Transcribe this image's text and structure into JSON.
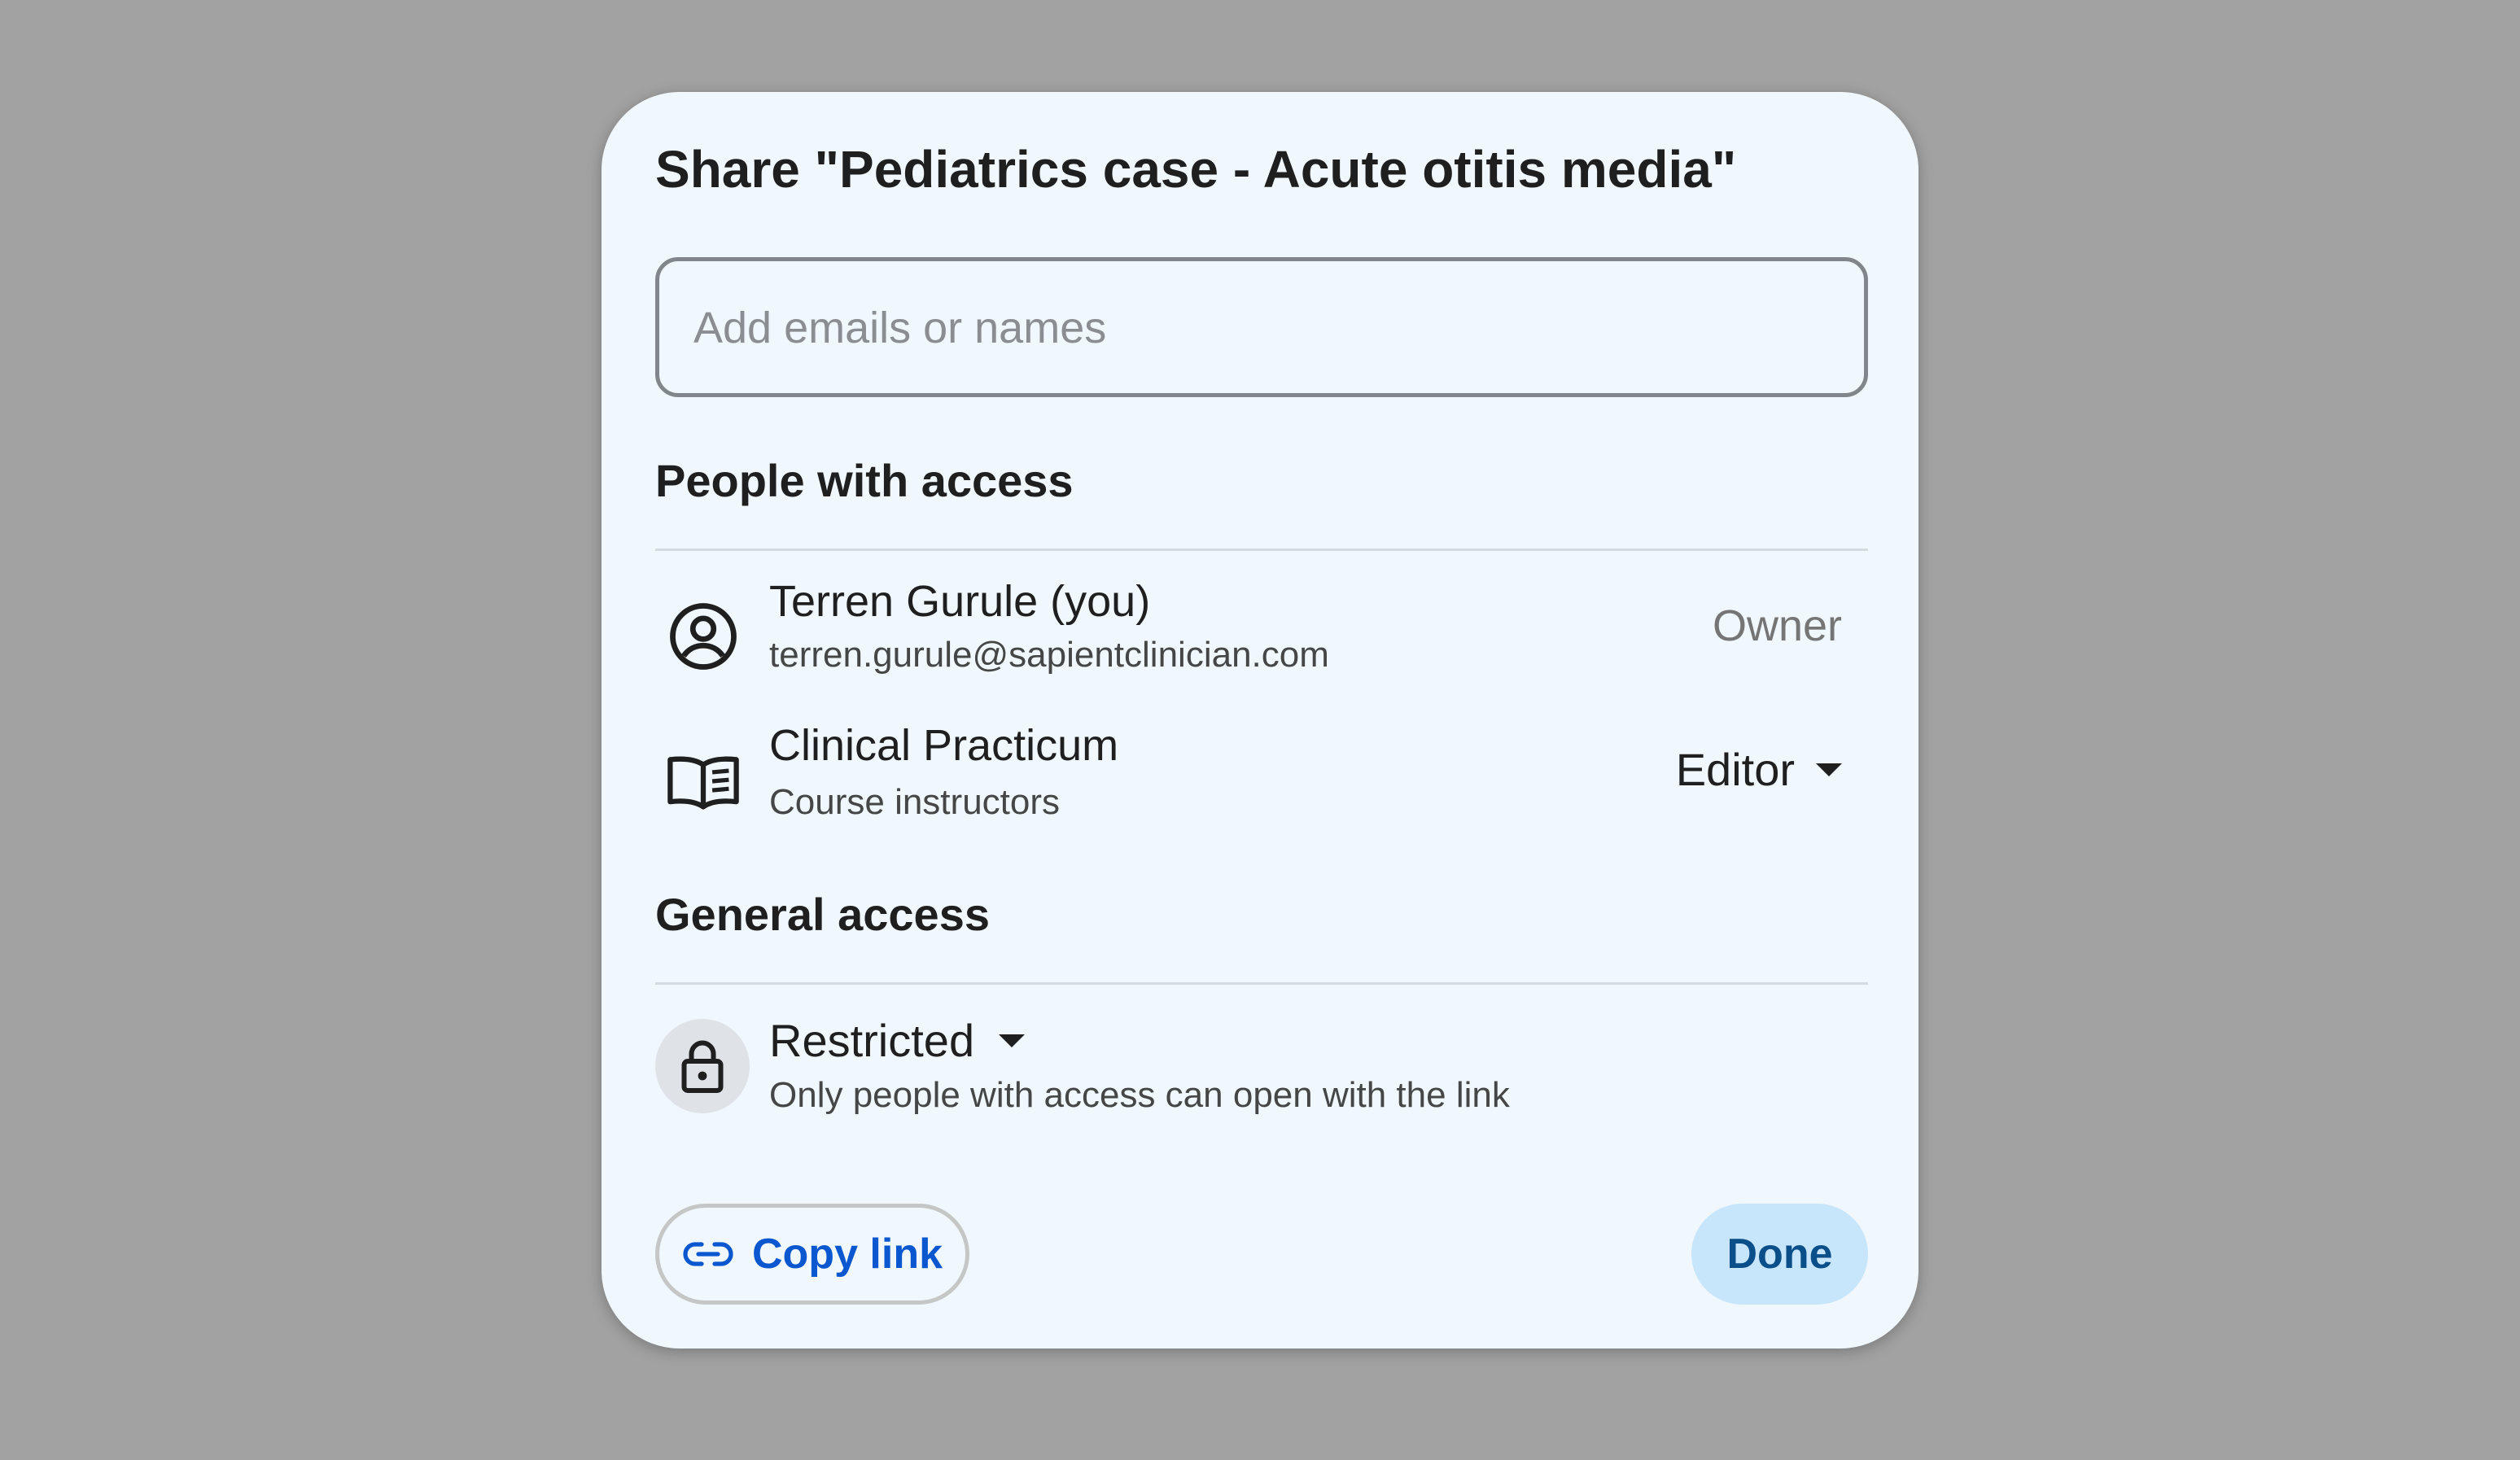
{
  "dialog": {
    "title": "Share \"Pediatrics case - Acute otitis media\""
  },
  "search": {
    "placeholder": "Add emails or names",
    "value": ""
  },
  "people_section": {
    "title": "People with access",
    "members": [
      {
        "icon": "account-circle-icon",
        "name": "Terren Gurule (you)",
        "detail": "terren.gurule@sapientclinician.com",
        "role": "Owner"
      },
      {
        "icon": "book-icon",
        "name": "Clinical Practicum",
        "detail": "Course instructors",
        "role": "Editor"
      }
    ]
  },
  "general_access": {
    "title": "General access",
    "icon": "lock-icon",
    "level": "Restricted",
    "description": "Only people with access can open with the link"
  },
  "footer": {
    "copy_link_label": "Copy link",
    "copy_link_icon": "link-icon",
    "done_label": "Done"
  },
  "colors": {
    "background": "#a2a2a2",
    "dialog_bg": "#f0f7fd",
    "accent": "#0b57d0",
    "done_bg": "#c8e6fb"
  }
}
